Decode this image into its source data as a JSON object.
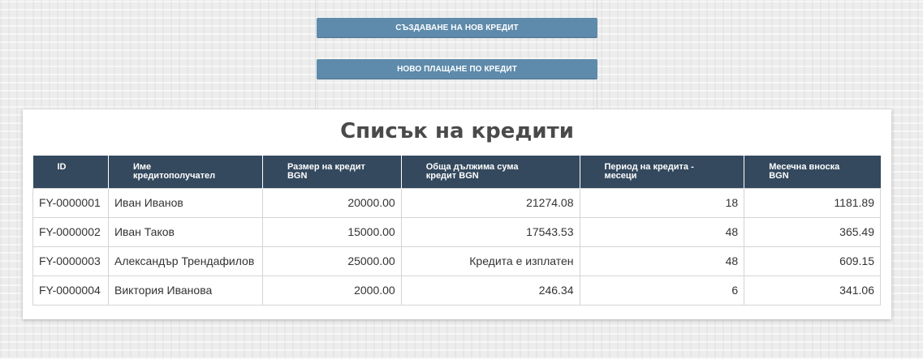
{
  "actions": {
    "create_loan": "СЪЗДАВАНЕ НА НОВ КРЕДИТ",
    "new_payment": "НОВО ПЛАЩАНЕ ПО КРЕДИТ"
  },
  "list": {
    "title": "Списък на кредити",
    "headers": {
      "id": "ID",
      "name_line1": "Име",
      "name_line2": "кредитополучател",
      "amount_line1": "Размер на кредит",
      "amount_line2": "BGN",
      "total_line1": "Обща дължима сума",
      "total_line2": "кредит BGN",
      "period_line1": "Период на кредита -",
      "period_line2": "месеци",
      "monthly_line1": "Месечна вноска",
      "monthly_line2": "BGN"
    },
    "rows": [
      {
        "id": "FY-0000001",
        "name": "Иван Иванов",
        "amount": "20000.00",
        "total": "21274.08",
        "period": "18",
        "monthly": "1181.89"
      },
      {
        "id": "FY-0000002",
        "name": "Иван Таков",
        "amount": "15000.00",
        "total": "17543.53",
        "period": "48",
        "monthly": "365.49"
      },
      {
        "id": "FY-0000003",
        "name": "Александър Трендафилов",
        "amount": "25000.00",
        "total": "Кредита е изплатен",
        "period": "48",
        "monthly": "609.15"
      },
      {
        "id": "FY-0000004",
        "name": "Виктория Иванова",
        "amount": "2000.00",
        "total": "246.34",
        "period": "6",
        "monthly": "341.06"
      }
    ]
  },
  "colors": {
    "button": "#5e8bab",
    "table_header": "#34495e",
    "title": "#4a4a4a"
  }
}
